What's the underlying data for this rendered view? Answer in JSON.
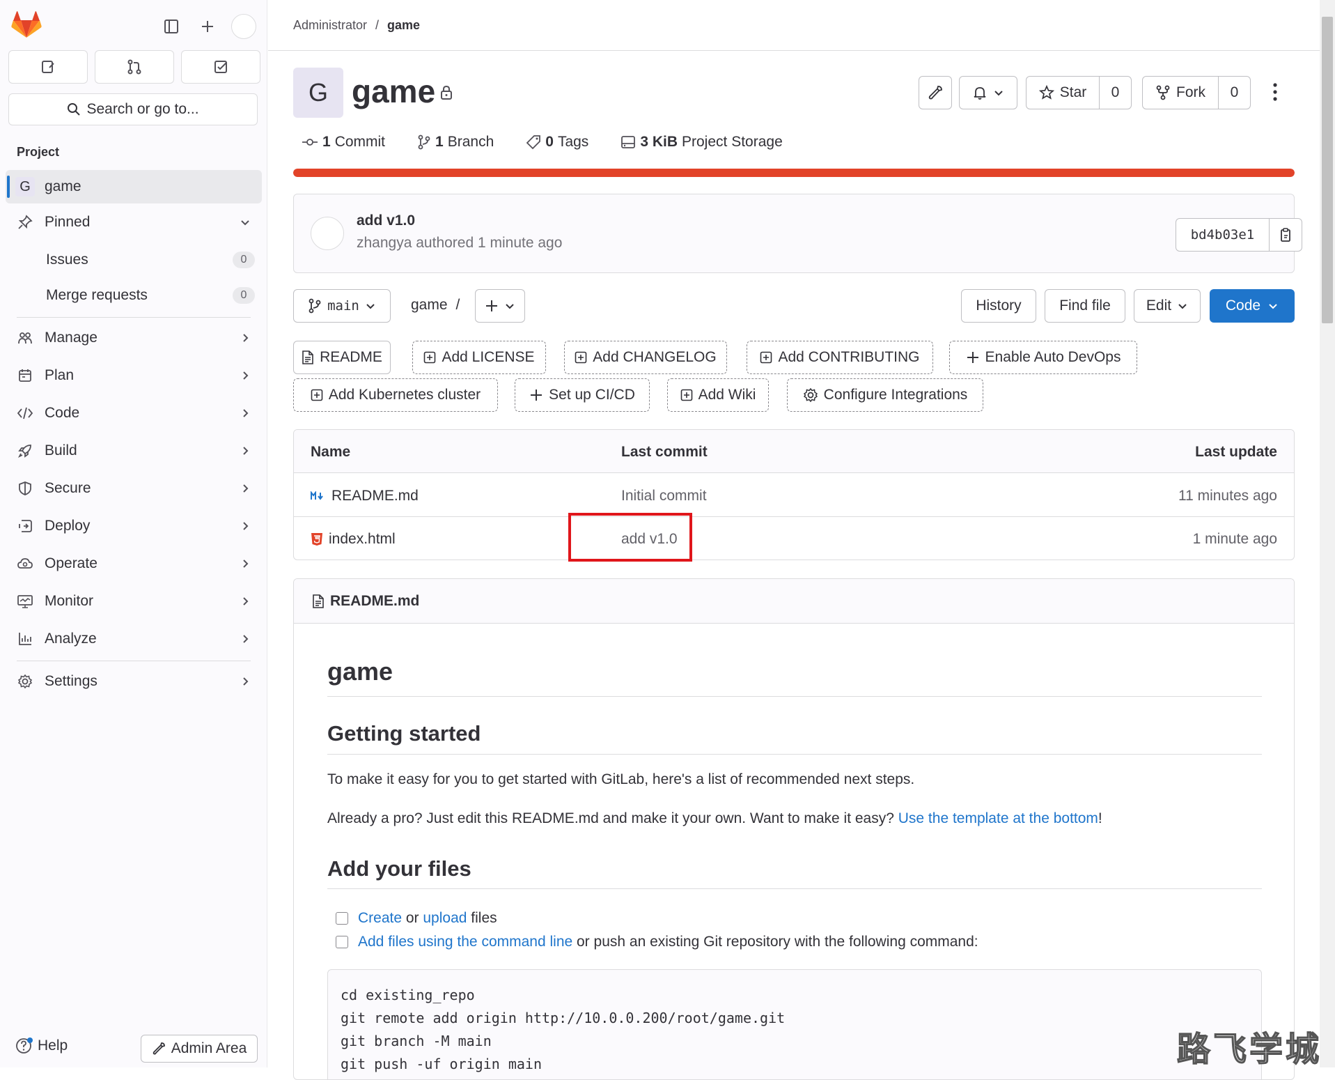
{
  "sidebar": {
    "search_label": "Search or go to...",
    "section_label": "Project",
    "project_item": {
      "letter": "G",
      "label": "game"
    },
    "pinned_label": "Pinned",
    "pinned_items": [
      {
        "label": "Issues",
        "count": "0"
      },
      {
        "label": "Merge requests",
        "count": "0"
      }
    ],
    "nav_items": [
      {
        "label": "Manage",
        "icon": "users-icon"
      },
      {
        "label": "Plan",
        "icon": "calendar-icon"
      },
      {
        "label": "Code",
        "icon": "code-icon"
      },
      {
        "label": "Build",
        "icon": "rocket-icon"
      },
      {
        "label": "Secure",
        "icon": "shield-icon"
      },
      {
        "label": "Deploy",
        "icon": "deploy-icon"
      },
      {
        "label": "Operate",
        "icon": "cloud-gear-icon"
      },
      {
        "label": "Monitor",
        "icon": "monitor-icon"
      },
      {
        "label": "Analyze",
        "icon": "chart-icon"
      }
    ],
    "settings_label": "Settings",
    "help_label": "Help",
    "admin_label": "Admin Area"
  },
  "breadcrumb": {
    "root": "Administrator",
    "sep": "/",
    "current": "game"
  },
  "project": {
    "avatar_letter": "G",
    "title": "game",
    "star_label": "Star",
    "star_count": "0",
    "fork_label": "Fork",
    "fork_count": "0"
  },
  "stats": {
    "commits_num": "1",
    "commits_label": "Commit",
    "branches_num": "1",
    "branches_label": "Branch",
    "tags_num": "0",
    "tags_label": "Tags",
    "storage_num": "3 KiB",
    "storage_label": "Project Storage"
  },
  "storage_usage_fraction": 1.0,
  "colors": {
    "accent": "#1f75cb",
    "storage_bar": "#e24329",
    "highlight_box": "#e0161b",
    "html_file_icon": "#e24329",
    "md_file_icon": "#1f75cb"
  },
  "last_commit": {
    "title": "add v1.0",
    "author": "zhangya",
    "meta_suffix": "authored 1 minute ago",
    "sha": "bd4b03e1"
  },
  "repo_bar": {
    "branch": "main",
    "path_root": "game",
    "path_sep": "/",
    "history_label": "History",
    "find_file_label": "Find file",
    "edit_label": "Edit",
    "code_label": "Code"
  },
  "quick_actions": [
    "README",
    "Add LICENSE",
    "Add CHANGELOG",
    "Add CONTRIBUTING",
    "Enable Auto DevOps",
    "Add Kubernetes cluster",
    "Set up CI/CD",
    "Add Wiki",
    "Configure Integrations"
  ],
  "file_table": {
    "headers": {
      "name": "Name",
      "last_commit": "Last commit",
      "last_update": "Last update"
    },
    "rows": [
      {
        "name": "README.md",
        "commit": "Initial commit",
        "updated": "11 minutes ago",
        "icon": "markdown-icon"
      },
      {
        "name": "index.html",
        "commit": "add v1.0",
        "updated": "1 minute ago",
        "icon": "html5-icon"
      }
    ]
  },
  "readme": {
    "file_label": "README.md",
    "h1": "game",
    "h2_getting_started": "Getting started",
    "p1": "To make it easy for you to get started with GitLab, here's a list of recommended next steps.",
    "p2_prefix": "Already a pro? Just edit this README.md and make it your own. Want to make it easy? ",
    "p2_link": "Use the template at the bottom",
    "p2_suffix": "!",
    "h2_add_files": "Add your files",
    "check1": {
      "link1": "Create",
      "mid": " or ",
      "link2": "upload",
      "suffix": " files"
    },
    "check2": {
      "link": "Add files using the command line",
      "suffix": " or push an existing Git repository with the following command:"
    },
    "code_lines": [
      "cd existing_repo",
      "git remote add origin http://10.0.0.200/root/game.git",
      "git branch -M main",
      "git push -uf origin main"
    ]
  },
  "watermark": "路飞学城"
}
